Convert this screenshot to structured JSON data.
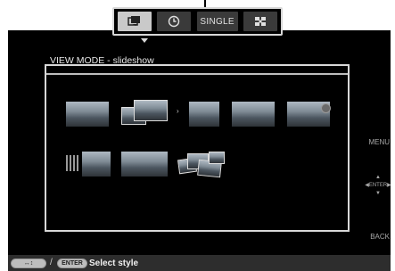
{
  "tabs": [
    {
      "icon": "slideshow-icon",
      "label": "",
      "selected": true
    },
    {
      "icon": "clock-icon",
      "label": "",
      "selected": false
    },
    {
      "icon": "",
      "label": "SINGLE",
      "selected": false
    },
    {
      "icon": "grid-icon",
      "label": "",
      "selected": false
    }
  ],
  "view_mode_title": "VIEW MODE - slideshow",
  "side_controls": {
    "menu": "MENU",
    "enter": "ENTER",
    "back": "BACK"
  },
  "status_bar": {
    "arrows_key": "↔↕",
    "slash": "/",
    "enter_key": "ENTER",
    "hint": "Select style"
  },
  "styles": [
    {
      "name": "style-1"
    },
    {
      "name": "style-2"
    },
    {
      "name": "style-3"
    },
    {
      "name": "style-4"
    },
    {
      "name": "style-5"
    },
    {
      "name": "style-6"
    },
    {
      "name": "style-7"
    },
    {
      "name": "style-8"
    }
  ],
  "colors": {
    "background": "#000000",
    "selected_tab": "#c9c9c9",
    "frame_border": "#d8d8d8"
  }
}
